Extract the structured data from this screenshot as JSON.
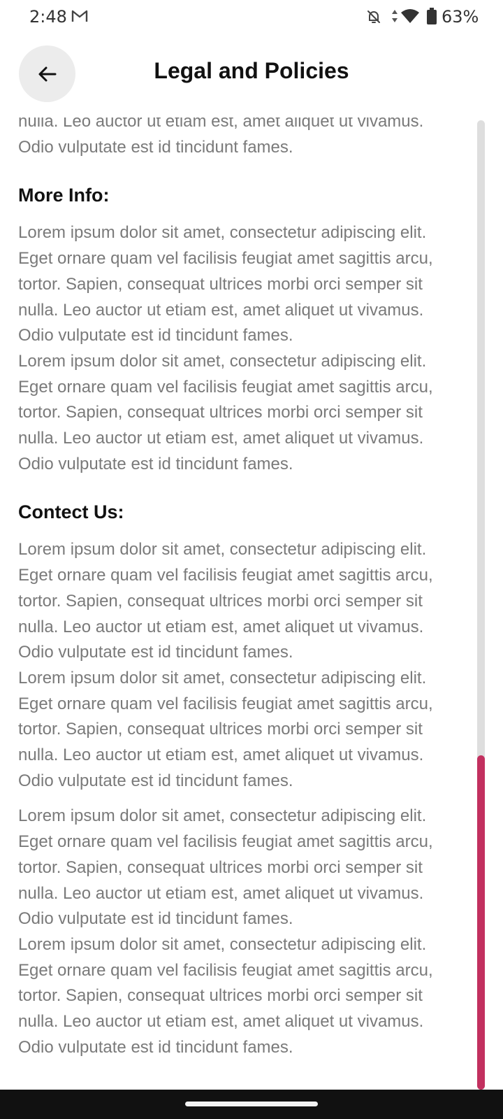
{
  "status_bar": {
    "time": "2:48",
    "battery": "63%",
    "icons": [
      "gmail-icon",
      "bell-off-icon",
      "data-icon",
      "wifi-icon",
      "battery-icon"
    ]
  },
  "header": {
    "title": "Legal and Policies",
    "back_icon": "arrow-left-icon"
  },
  "content": {
    "top_fragment": "nulla. Leo auctor ut etiam est, amet aliquet ut vivamus.\nOdio vulputate est id tincidunt fames.",
    "sections": [
      {
        "heading": "More Info:",
        "paragraphs": [
          "Lorem ipsum dolor sit amet, consectetur adipiscing elit.\nEget ornare quam vel facilisis feugiat amet sagittis arcu,\ntortor. Sapien, consequat ultrices morbi orci semper sit\nnulla. Leo auctor ut etiam est, amet aliquet ut vivamus.\nOdio vulputate est id tincidunt fames.",
          "Lorem ipsum dolor sit amet, consectetur adipiscing elit.\nEget ornare quam vel facilisis feugiat amet sagittis arcu,\ntortor. Sapien, consequat ultrices morbi orci semper sit\nnulla. Leo auctor ut etiam est, amet aliquet ut vivamus.\nOdio vulputate est id tincidunt fames."
        ]
      },
      {
        "heading": "Contect Us:",
        "paragraphs": [
          "Lorem ipsum dolor sit amet, consectetur adipiscing elit.\nEget ornare quam vel facilisis feugiat amet sagittis arcu,\ntortor. Sapien, consequat ultrices morbi orci semper sit\nnulla. Leo auctor ut etiam est, amet aliquet ut vivamus.\nOdio vulputate est id tincidunt fames.",
          "Lorem ipsum dolor sit amet, consectetur adipiscing elit.\nEget ornare quam vel facilisis feugiat amet sagittis arcu,\ntortor. Sapien, consequat ultrices morbi orci semper sit\nnulla. Leo auctor ut etiam est, amet aliquet ut vivamus.\nOdio vulputate est id tincidunt fames.",
          "Lorem ipsum dolor sit amet, consectetur adipiscing elit.\nEget ornare quam vel facilisis feugiat amet sagittis arcu,\ntortor. Sapien, consequat ultrices morbi orci semper sit\nnulla. Leo auctor ut etiam est, amet aliquet ut vivamus.\nOdio vulputate est id tincidunt fames.",
          "Lorem ipsum dolor sit amet, consectetur adipiscing elit.\nEget ornare quam vel facilisis feugiat amet sagittis arcu,\ntortor. Sapien, consequat ultrices morbi orci semper sit\nnulla. Leo auctor ut etiam est, amet aliquet ut vivamus.\nOdio vulputate est id tincidunt fames."
        ]
      }
    ]
  },
  "scroll": {
    "position_fraction": 1.0
  },
  "colors": {
    "accent": "#c2305f",
    "body_text": "#7a7a7a",
    "heading_text": "#111111",
    "back_button_bg": "#ececec"
  }
}
